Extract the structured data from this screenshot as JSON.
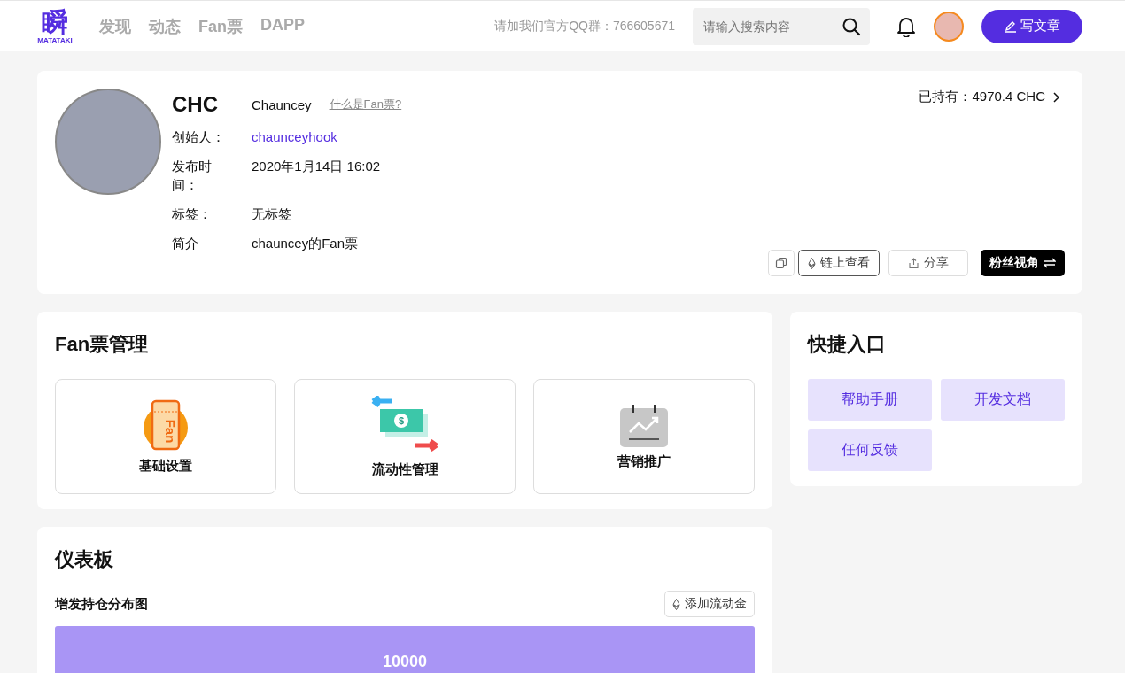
{
  "header": {
    "logo_text": "MATATAKI",
    "logo_char": "瞬",
    "nav": [
      {
        "label": "发现",
        "selected": false
      },
      {
        "label": "动态",
        "selected": false
      },
      {
        "label": "Fan票",
        "selected": false
      },
      {
        "label": "DAPP",
        "selected": false
      }
    ],
    "qq_notice": "请加我们官方QQ群：766605671",
    "search": {
      "placeholder": "请输入搜索内容"
    },
    "write_button": "写文章"
  },
  "token": {
    "symbol": "CHC",
    "name": "Chauncey",
    "what_link": "什么是Fan票?",
    "holding": "已持有：4970.4 CHC",
    "fields": [
      {
        "label": "创始人：",
        "value": "chaunceyhook",
        "kind": "link"
      },
      {
        "label": "发布时间：",
        "value": "2020年1月14日 16:02",
        "kind": "text"
      },
      {
        "label": "标签：",
        "value": "无标签",
        "kind": "text"
      },
      {
        "label": "简介",
        "value": "chauncey的Fan票",
        "kind": "text"
      }
    ],
    "buttons": [
      {
        "label": "链上查看",
        "kind": "outline"
      },
      {
        "label": "分享",
        "kind": "light"
      },
      {
        "label": "粉丝视角",
        "kind": "dark"
      }
    ]
  },
  "management": {
    "title": "Fan票管理",
    "cards": [
      {
        "label": "基础设置",
        "kind": "ticket",
        "glyph": "Fan"
      },
      {
        "label": "流动性管理",
        "kind": "money",
        "glyph": "$"
      },
      {
        "label": "营销推广",
        "kind": "calendar"
      }
    ]
  },
  "shortcuts": {
    "title": "快捷入口",
    "items": [
      "帮助手册",
      "开发文档",
      "任何反馈"
    ]
  },
  "dashboard": {
    "title": "仪表板",
    "chart_title": "增发持仓分布图",
    "add_button": "添加流动金",
    "chart_label": "10000"
  }
}
